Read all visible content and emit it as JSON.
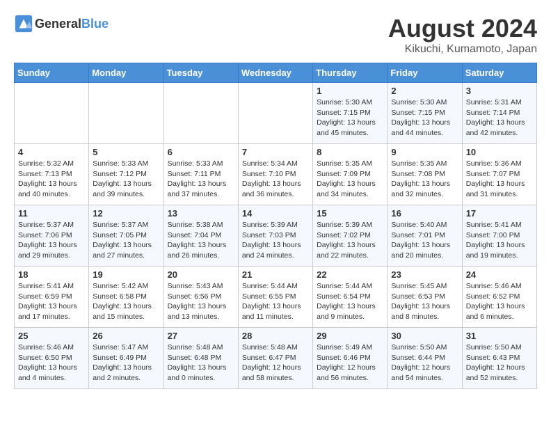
{
  "header": {
    "logo_general": "General",
    "logo_blue": "Blue",
    "title": "August 2024",
    "subtitle": "Kikuchi, Kumamoto, Japan"
  },
  "days_of_week": [
    "Sunday",
    "Monday",
    "Tuesday",
    "Wednesday",
    "Thursday",
    "Friday",
    "Saturday"
  ],
  "weeks": [
    [
      {
        "day": "",
        "info": ""
      },
      {
        "day": "",
        "info": ""
      },
      {
        "day": "",
        "info": ""
      },
      {
        "day": "",
        "info": ""
      },
      {
        "day": "1",
        "info": "Sunrise: 5:30 AM\nSunset: 7:15 PM\nDaylight: 13 hours\nand 45 minutes."
      },
      {
        "day": "2",
        "info": "Sunrise: 5:30 AM\nSunset: 7:15 PM\nDaylight: 13 hours\nand 44 minutes."
      },
      {
        "day": "3",
        "info": "Sunrise: 5:31 AM\nSunset: 7:14 PM\nDaylight: 13 hours\nand 42 minutes."
      }
    ],
    [
      {
        "day": "4",
        "info": "Sunrise: 5:32 AM\nSunset: 7:13 PM\nDaylight: 13 hours\nand 40 minutes."
      },
      {
        "day": "5",
        "info": "Sunrise: 5:33 AM\nSunset: 7:12 PM\nDaylight: 13 hours\nand 39 minutes."
      },
      {
        "day": "6",
        "info": "Sunrise: 5:33 AM\nSunset: 7:11 PM\nDaylight: 13 hours\nand 37 minutes."
      },
      {
        "day": "7",
        "info": "Sunrise: 5:34 AM\nSunset: 7:10 PM\nDaylight: 13 hours\nand 36 minutes."
      },
      {
        "day": "8",
        "info": "Sunrise: 5:35 AM\nSunset: 7:09 PM\nDaylight: 13 hours\nand 34 minutes."
      },
      {
        "day": "9",
        "info": "Sunrise: 5:35 AM\nSunset: 7:08 PM\nDaylight: 13 hours\nand 32 minutes."
      },
      {
        "day": "10",
        "info": "Sunrise: 5:36 AM\nSunset: 7:07 PM\nDaylight: 13 hours\nand 31 minutes."
      }
    ],
    [
      {
        "day": "11",
        "info": "Sunrise: 5:37 AM\nSunset: 7:06 PM\nDaylight: 13 hours\nand 29 minutes."
      },
      {
        "day": "12",
        "info": "Sunrise: 5:37 AM\nSunset: 7:05 PM\nDaylight: 13 hours\nand 27 minutes."
      },
      {
        "day": "13",
        "info": "Sunrise: 5:38 AM\nSunset: 7:04 PM\nDaylight: 13 hours\nand 26 minutes."
      },
      {
        "day": "14",
        "info": "Sunrise: 5:39 AM\nSunset: 7:03 PM\nDaylight: 13 hours\nand 24 minutes."
      },
      {
        "day": "15",
        "info": "Sunrise: 5:39 AM\nSunset: 7:02 PM\nDaylight: 13 hours\nand 22 minutes."
      },
      {
        "day": "16",
        "info": "Sunrise: 5:40 AM\nSunset: 7:01 PM\nDaylight: 13 hours\nand 20 minutes."
      },
      {
        "day": "17",
        "info": "Sunrise: 5:41 AM\nSunset: 7:00 PM\nDaylight: 13 hours\nand 19 minutes."
      }
    ],
    [
      {
        "day": "18",
        "info": "Sunrise: 5:41 AM\nSunset: 6:59 PM\nDaylight: 13 hours\nand 17 minutes."
      },
      {
        "day": "19",
        "info": "Sunrise: 5:42 AM\nSunset: 6:58 PM\nDaylight: 13 hours\nand 15 minutes."
      },
      {
        "day": "20",
        "info": "Sunrise: 5:43 AM\nSunset: 6:56 PM\nDaylight: 13 hours\nand 13 minutes."
      },
      {
        "day": "21",
        "info": "Sunrise: 5:44 AM\nSunset: 6:55 PM\nDaylight: 13 hours\nand 11 minutes."
      },
      {
        "day": "22",
        "info": "Sunrise: 5:44 AM\nSunset: 6:54 PM\nDaylight: 13 hours\nand 9 minutes."
      },
      {
        "day": "23",
        "info": "Sunrise: 5:45 AM\nSunset: 6:53 PM\nDaylight: 13 hours\nand 8 minutes."
      },
      {
        "day": "24",
        "info": "Sunrise: 5:46 AM\nSunset: 6:52 PM\nDaylight: 13 hours\nand 6 minutes."
      }
    ],
    [
      {
        "day": "25",
        "info": "Sunrise: 5:46 AM\nSunset: 6:50 PM\nDaylight: 13 hours\nand 4 minutes."
      },
      {
        "day": "26",
        "info": "Sunrise: 5:47 AM\nSunset: 6:49 PM\nDaylight: 13 hours\nand 2 minutes."
      },
      {
        "day": "27",
        "info": "Sunrise: 5:48 AM\nSunset: 6:48 PM\nDaylight: 13 hours\nand 0 minutes."
      },
      {
        "day": "28",
        "info": "Sunrise: 5:48 AM\nSunset: 6:47 PM\nDaylight: 12 hours\nand 58 minutes."
      },
      {
        "day": "29",
        "info": "Sunrise: 5:49 AM\nSunset: 6:46 PM\nDaylight: 12 hours\nand 56 minutes."
      },
      {
        "day": "30",
        "info": "Sunrise: 5:50 AM\nSunset: 6:44 PM\nDaylight: 12 hours\nand 54 minutes."
      },
      {
        "day": "31",
        "info": "Sunrise: 5:50 AM\nSunset: 6:43 PM\nDaylight: 12 hours\nand 52 minutes."
      }
    ]
  ]
}
